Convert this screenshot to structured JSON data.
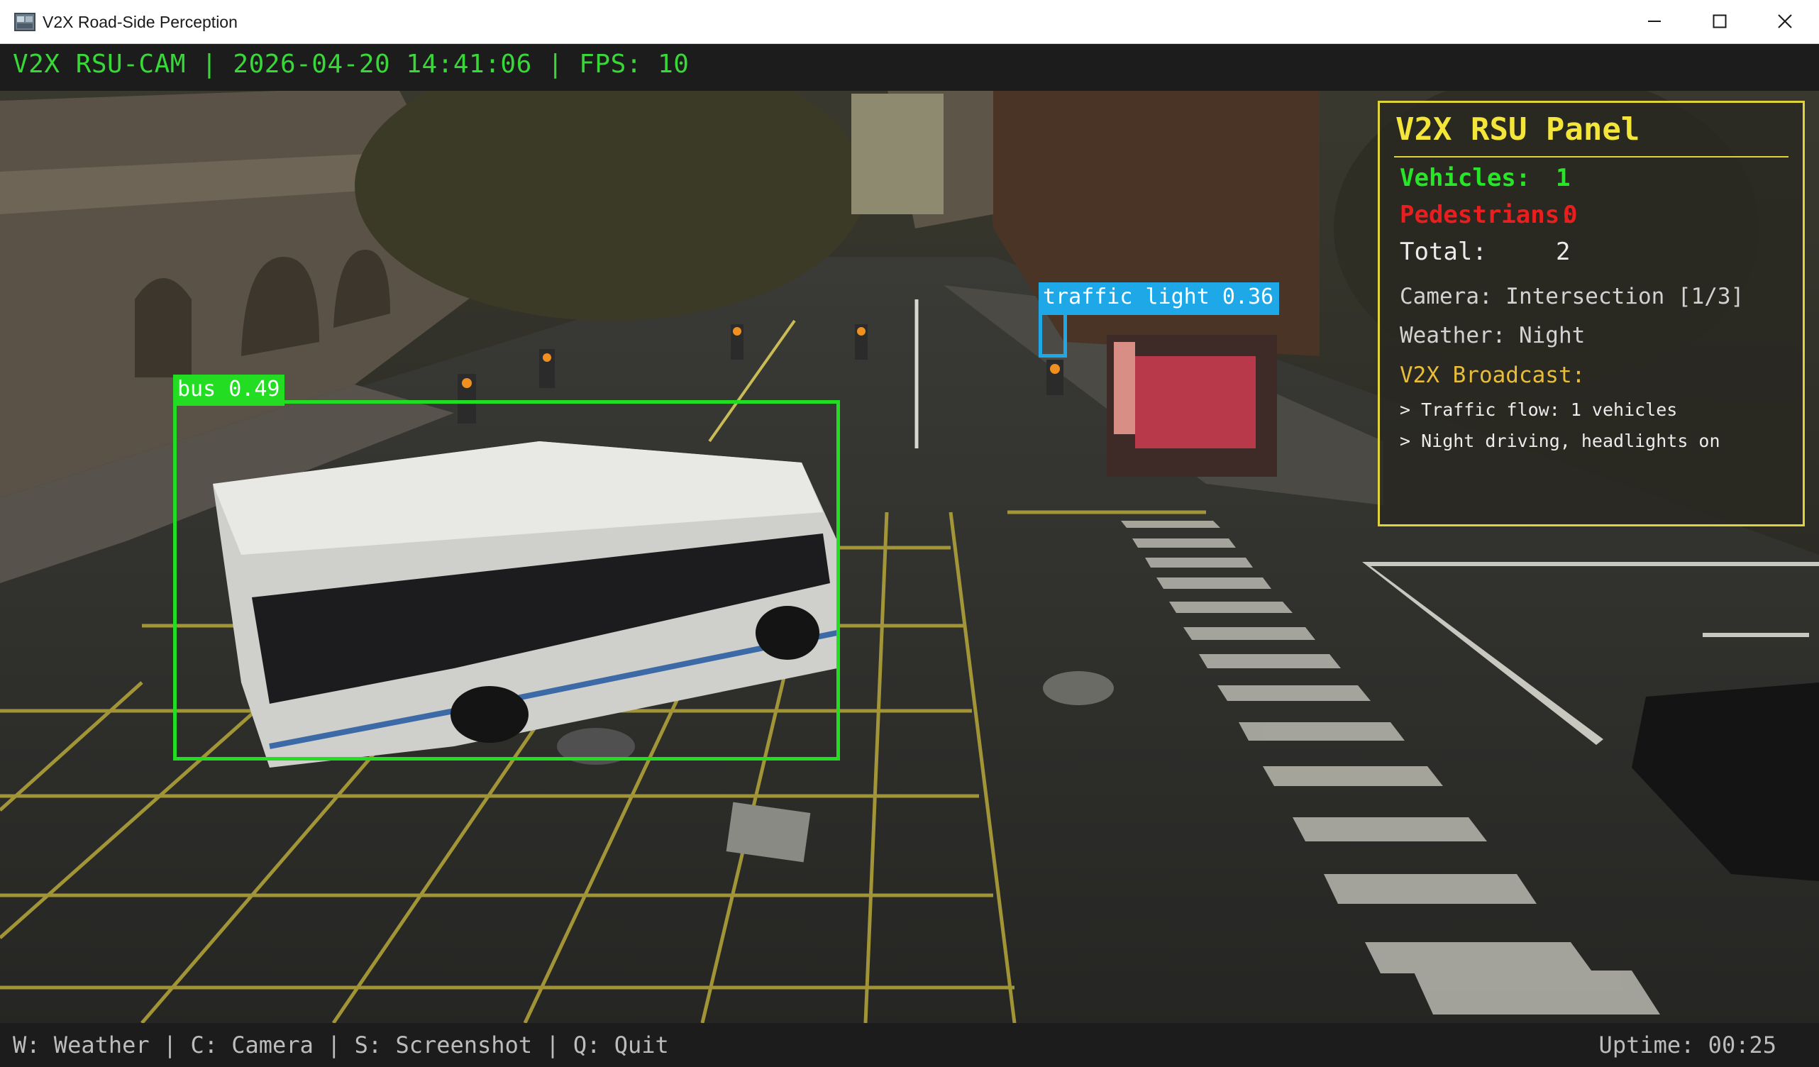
{
  "window": {
    "title": "V2X Road-Side Perception",
    "controls": [
      "minimize",
      "maximize",
      "close"
    ]
  },
  "status_bar": {
    "text": "V2X RSU-CAM | 2026-04-20 14:41:06 | FPS: 10",
    "color": "#38d838"
  },
  "detections": [
    {
      "label": "bus 0.49",
      "class": "bus",
      "confidence": 0.49,
      "color": "#22dd22"
    },
    {
      "label": "traffic light 0.36",
      "class": "traffic light",
      "confidence": 0.36,
      "color": "#1ea8e8"
    }
  ],
  "panel": {
    "title": "V2X RSU Panel",
    "vehicles_label": "Vehicles:",
    "vehicles_value": "1",
    "pedestrians_label": "Pedestrians:",
    "pedestrians_value": "0",
    "total_label": "Total:",
    "total_value": "2",
    "camera": "Camera: Intersection [1/3]",
    "weather": "Weather: Night",
    "broadcast_title": "V2X Broadcast:",
    "messages": [
      "> Traffic flow: 1 vehicles",
      "> Night driving, headlights on"
    ],
    "border_color": "#e0d23a"
  },
  "footer": {
    "hotkeys": "W: Weather | C: Camera | S: Screenshot | Q: Quit",
    "uptime": "Uptime: 00:25"
  },
  "icons": [
    "app-icon",
    "minimize-icon",
    "maximize-icon",
    "close-icon"
  ]
}
